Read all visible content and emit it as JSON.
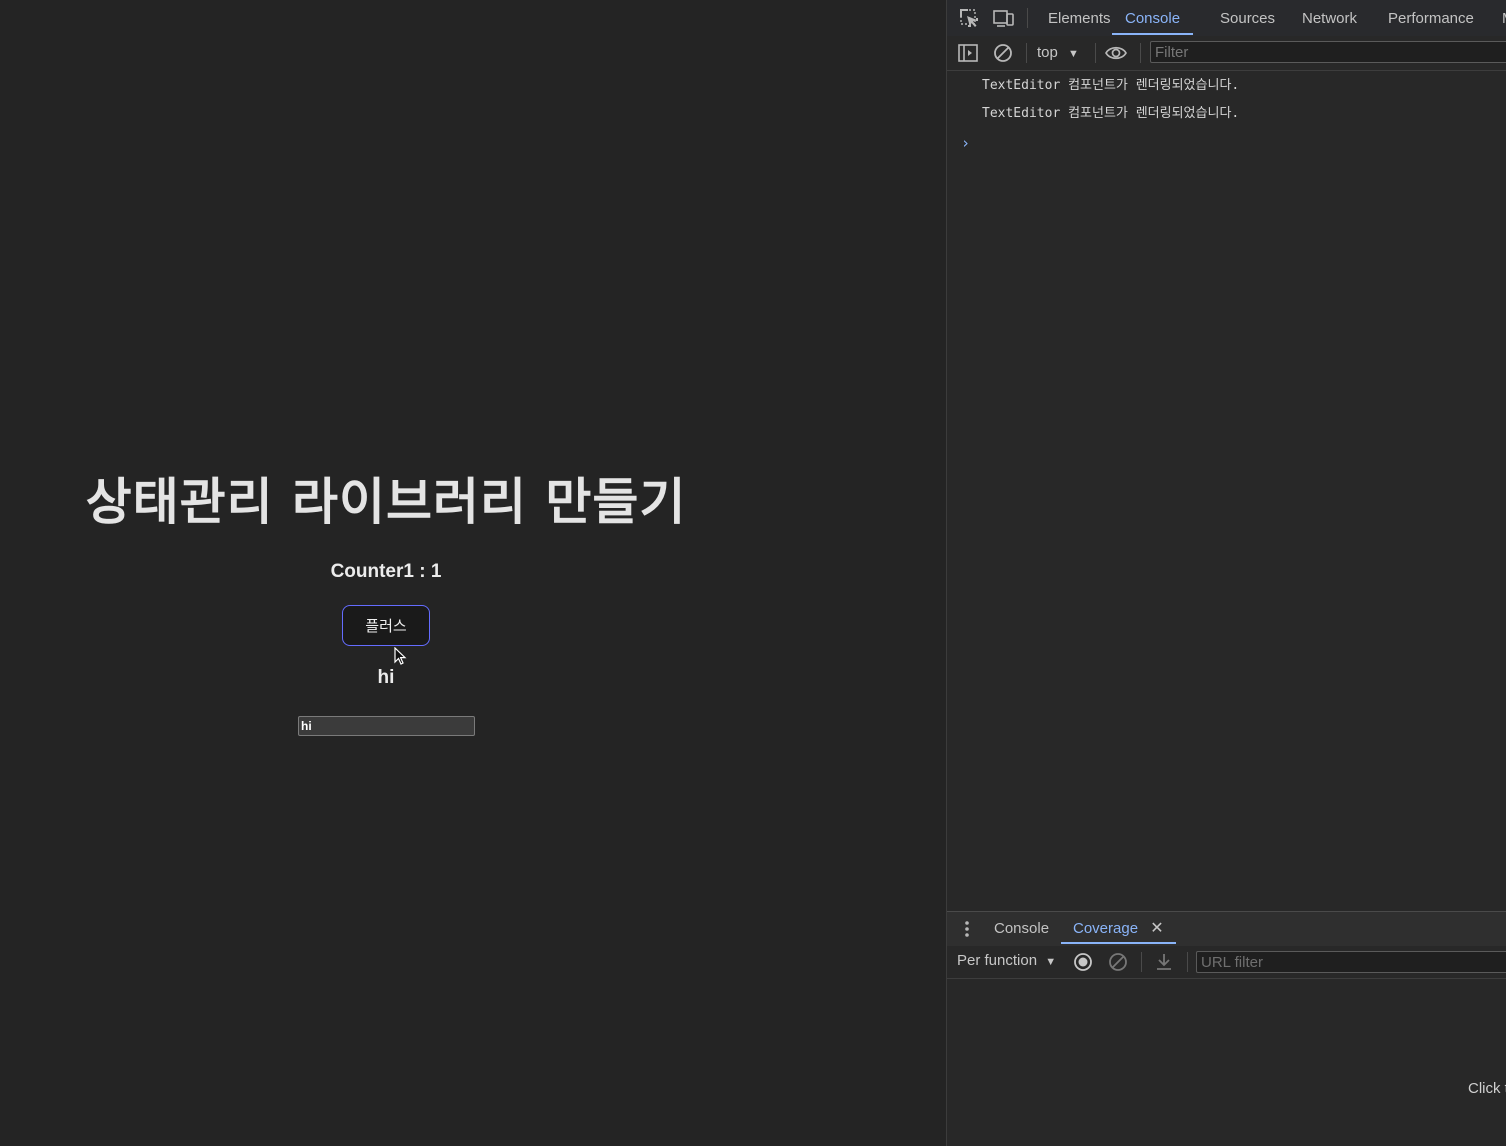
{
  "app": {
    "title": "상태관리 라이브러리 만들기",
    "counter_label": "Counter1 : 1",
    "plus_button_label": "플러스",
    "text_display": "hi",
    "text_input_value": "hi"
  },
  "devtools": {
    "tabs": [
      "Elements",
      "Console",
      "Sources",
      "Network",
      "Performance",
      "M"
    ],
    "active_tab": "Console",
    "context": "top",
    "filter_placeholder": "Filter",
    "logs": [
      "TextEditor 컴포넌트가 렌더링되었습니다.",
      "TextEditor 컴포넌트가 렌더링되었습니다."
    ],
    "drawer": {
      "tabs": [
        "Console",
        "Coverage"
      ],
      "active_tab": "Coverage",
      "per_function_label": "Per function",
      "url_filter_placeholder": "URL filter",
      "hint_text": "Click t"
    }
  },
  "colors": {
    "page_bg": "#242424",
    "button_border": "#646cff",
    "devtools_accent": "#8ab4f8"
  }
}
